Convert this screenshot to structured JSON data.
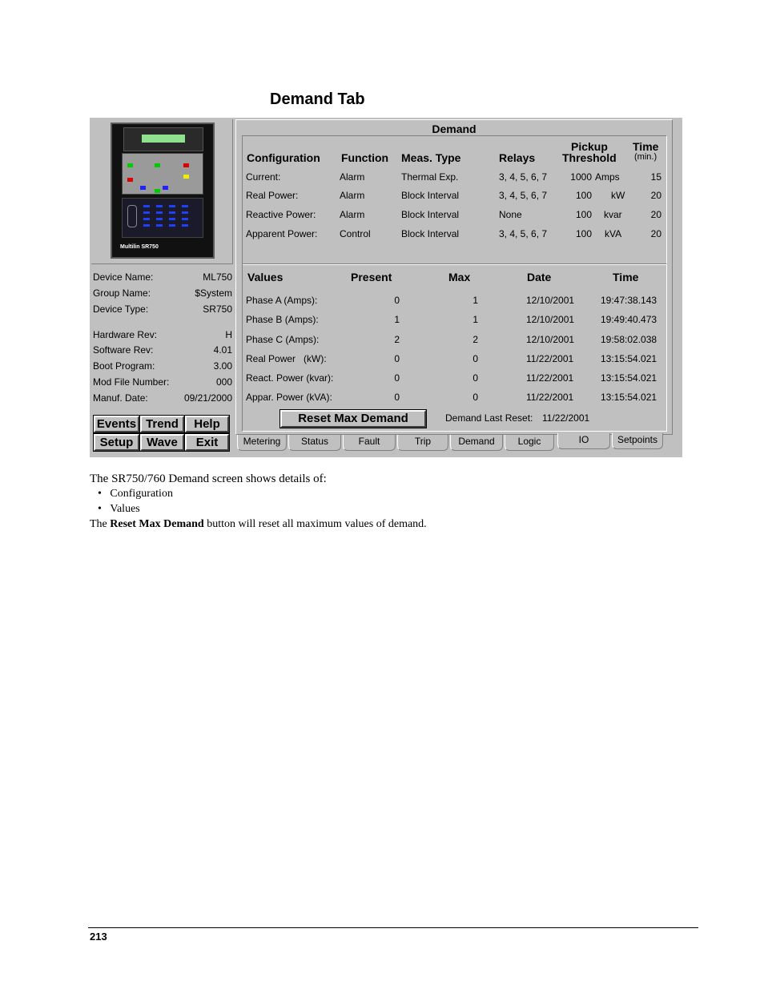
{
  "heading": "Demand Tab",
  "screenshot": {
    "device_logo": "Multilin SR750",
    "device_info": [
      {
        "key": "Device Name:",
        "value": "ML750"
      },
      {
        "key": "Group Name:",
        "value": "$System"
      },
      {
        "key": "Device Type:",
        "value": "SR750"
      },
      {
        "key": "Hardware Rev:",
        "value": "H"
      },
      {
        "key": "Software Rev:",
        "value": "4.01"
      },
      {
        "key": "Boot Program:",
        "value": "3.00"
      },
      {
        "key": "Mod File Number:",
        "value": "000"
      },
      {
        "key": "Manuf. Date:",
        "value": "09/21/2000"
      }
    ],
    "buttons": {
      "events": "Events",
      "trend": "Trend",
      "help": "Help",
      "setup": "Setup",
      "wave": "Wave",
      "exit": "Exit"
    },
    "panel_title": "Demand",
    "config": {
      "headers": {
        "configuration": "Configuration",
        "function": "Function",
        "meas_type": "Meas. Type",
        "relays": "Relays",
        "pickup": "Pickup",
        "threshold": "Threshold",
        "time": "Time",
        "time_unit": "(min.)"
      },
      "rows": [
        {
          "name": "Current:",
          "function": "Alarm",
          "meas": "Thermal Exp.",
          "relays": "3, 4, 5, 6, 7",
          "threshold": "1000",
          "unit": "Amps",
          "time": "15"
        },
        {
          "name": "Real Power:",
          "function": "Alarm",
          "meas": "Block Interval",
          "relays": "3, 4, 5, 6, 7",
          "threshold": "100",
          "unit": "kW",
          "time": "20"
        },
        {
          "name": "Reactive Power:",
          "function": "Alarm",
          "meas": "Block Interval",
          "relays": "None",
          "threshold": "100",
          "unit": "kvar",
          "time": "20"
        },
        {
          "name": "Apparent Power:",
          "function": "Control",
          "meas": "Block Interval",
          "relays": "3, 4, 5, 6, 7",
          "threshold": "100",
          "unit": "kVA",
          "time": "20"
        }
      ]
    },
    "values": {
      "headers": {
        "values": "Values",
        "present": "Present",
        "max": "Max",
        "date": "Date",
        "time": "Time"
      },
      "rows": [
        {
          "name": "Phase A (Amps):",
          "present": "0",
          "max": "1",
          "date": "12/10/2001",
          "time": "19:47:38.143"
        },
        {
          "name": "Phase B (Amps):",
          "present": "1",
          "max": "1",
          "date": "12/10/2001",
          "time": "19:49:40.473"
        },
        {
          "name": "Phase C (Amps):",
          "present": "2",
          "max": "2",
          "date": "12/10/2001",
          "time": "19:58:02.038"
        },
        {
          "name": "Real Power   (kW):",
          "present": "0",
          "max": "0",
          "date": "11/22/2001",
          "time": "13:15:54.021"
        },
        {
          "name": "React. Power (kvar):",
          "present": "0",
          "max": "0",
          "date": "11/22/2001",
          "time": "13:15:54.021"
        },
        {
          "name": "Appar. Power (kVA):",
          "present": "0",
          "max": "0",
          "date": "11/22/2001",
          "time": "13:15:54.021"
        }
      ]
    },
    "reset_button": "Reset Max Demand",
    "last_reset_label": "Demand Last Reset:",
    "last_reset_date": "11/22/2001",
    "tabs": [
      "Metering",
      "Status",
      "Fault",
      "Trip",
      "Demand",
      "Logic",
      "IO",
      "Setpoints"
    ]
  },
  "body": {
    "intro": "The SR750/760 Demand screen shows details of:",
    "bullets": [
      "Configuration",
      "Values"
    ],
    "reset_pre": "The ",
    "reset_bold": "Reset Max Demand",
    "reset_post": " button will reset all maximum values of demand."
  },
  "page_number": "213"
}
